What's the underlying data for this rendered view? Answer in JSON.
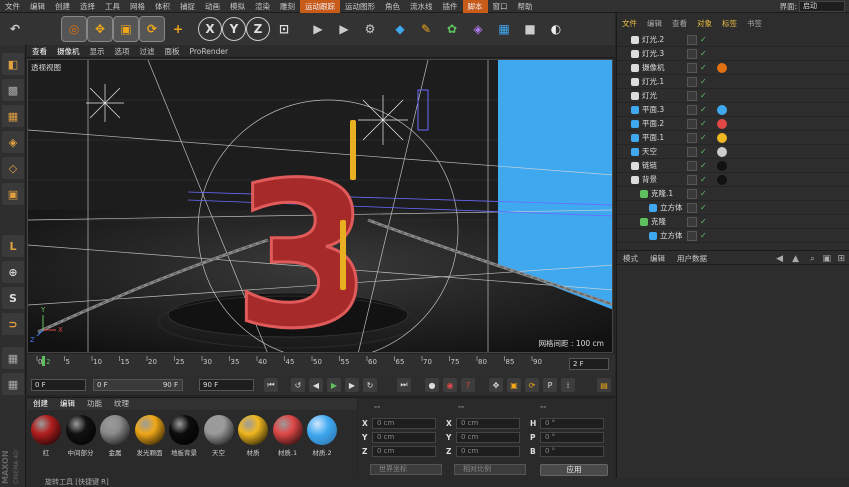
{
  "menubar": {
    "items": [
      "文件",
      "编辑",
      "创建",
      "选择",
      "工具",
      "网格",
      "体积",
      "捕捉",
      "动画",
      "模拟",
      "渲染",
      "雕刻",
      "运动跟踪",
      "运动图形",
      "角色",
      "流水线",
      "插件",
      "脚本",
      "窗口",
      "帮助"
    ],
    "highlighted": [
      "运动跟踪",
      "脚本"
    ],
    "layout_label": "界面:",
    "layout_value": "启动"
  },
  "toolbar": {
    "icons": [
      "undo-icon",
      "live-select-icon",
      "move-icon",
      "scale-icon",
      "rotate-icon",
      "add-icon",
      "x-axis-icon",
      "y-axis-icon",
      "z-axis-icon",
      "coordinate-system-icon",
      "render-region-icon",
      "render-to-viewer-icon",
      "render-settings-icon",
      "cube-icon",
      "pen-icon",
      "subdivision-icon",
      "deformer-icon",
      "scene-icon",
      "camera-icon",
      "light-icon"
    ],
    "axis_labels": [
      "X",
      "Y",
      "Z"
    ]
  },
  "viewport": {
    "menu": [
      "查看",
      "摄像机",
      "显示",
      "选项",
      "过滤",
      "面板",
      "ProRender"
    ],
    "highlighted": [
      "查看",
      "摄像机"
    ],
    "label": "透视视图",
    "grid_spacing": "网格间距 : 100 cm",
    "scene_number": "3",
    "accent_red": "#c83a3a",
    "accent_yellow": "#e8b020",
    "accent_blue": "#3fa8ef"
  },
  "timeline": {
    "ticks": [
      "0",
      "5",
      "10",
      "15",
      "20",
      "25",
      "30",
      "35",
      "40",
      "45",
      "50",
      "55",
      "60",
      "65",
      "70",
      "75",
      "80",
      "85",
      "90"
    ],
    "current_frame": "2 F",
    "playhead_marker": "2"
  },
  "transport": {
    "start": "0 F",
    "range_start": "0 F",
    "range_end": "90 F",
    "end": "90 F"
  },
  "materials": {
    "tabs": [
      "创建",
      "编辑",
      "功能",
      "纹理"
    ],
    "items": [
      {
        "label": "红",
        "color": "#b01e1e"
      },
      {
        "label": "中间部分",
        "color": "#111111"
      },
      {
        "label": "金属",
        "color": "#8a8a8a"
      },
      {
        "label": "发光颗面",
        "color": "#f0a818"
      },
      {
        "label": "地板背景",
        "color": "#0c0c0c"
      },
      {
        "label": "天空",
        "color": "#9a9a9a"
      },
      {
        "label": "材质",
        "color": "#f0b820"
      },
      {
        "label": "材质.1",
        "color": "#e04848"
      },
      {
        "label": "材质.2",
        "color": "#3fa8ef"
      }
    ]
  },
  "coordinates": {
    "header_left": "--",
    "header_mid": "--",
    "header_right": "--",
    "rows": [
      {
        "a": "X",
        "av": "0 cm",
        "b": "X",
        "bv": "0 cm",
        "c": "H",
        "cv": "0 °"
      },
      {
        "a": "Y",
        "av": "0 cm",
        "b": "Y",
        "bv": "0 cm",
        "c": "P",
        "cv": "0 °"
      },
      {
        "a": "Z",
        "av": "0 cm",
        "b": "Z",
        "bv": "0 cm",
        "c": "B",
        "cv": "0 °"
      }
    ],
    "mode_select": "世界坐标",
    "scale_select": "相对比例",
    "apply_label": "应用"
  },
  "object_manager": {
    "tabs": [
      "文件",
      "编辑",
      "查看",
      "对象",
      "标签",
      "书签"
    ],
    "highlighted": [
      "文件",
      "对象",
      "标签"
    ],
    "objects": [
      {
        "name": "灯光.2",
        "indent": 0,
        "type": "light",
        "tag": ""
      },
      {
        "name": "灯光.3",
        "indent": 0,
        "type": "light",
        "tag": ""
      },
      {
        "name": "摄像机",
        "indent": 0,
        "type": "camera",
        "tag": "#e07010"
      },
      {
        "name": "灯光.1",
        "indent": 0,
        "type": "light",
        "tag": ""
      },
      {
        "name": "灯光",
        "indent": 0,
        "type": "light",
        "tag": ""
      },
      {
        "name": "平面.3",
        "indent": 0,
        "type": "plane",
        "tag": "#3fa8ef"
      },
      {
        "name": "平面.2",
        "indent": 0,
        "type": "plane",
        "tag": "#e04848"
      },
      {
        "name": "平面.1",
        "indent": 0,
        "type": "plane",
        "tag": "#f0b820"
      },
      {
        "name": "天空",
        "indent": 0,
        "type": "sky",
        "tag": "#cccccc"
      },
      {
        "name": "链链",
        "indent": 0,
        "type": "null",
        "tag": "#111111"
      },
      {
        "name": "背景",
        "indent": 0,
        "type": "null",
        "tag": "#111111"
      },
      {
        "name": "克隆.1",
        "indent": 1,
        "type": "cloner",
        "tag": ""
      },
      {
        "name": "立方体",
        "indent": 2,
        "type": "cube",
        "tag": ""
      },
      {
        "name": "克隆",
        "indent": 1,
        "type": "cloner",
        "tag": ""
      },
      {
        "name": "立方体",
        "indent": 2,
        "type": "cube",
        "tag": ""
      }
    ]
  },
  "attribute_manager": {
    "tabs": [
      "模式",
      "编辑",
      "用户数据"
    ]
  },
  "statusbar": {
    "text": "旋转工具 [快捷键 R]"
  },
  "brand": {
    "line1": "MAXON",
    "line2": "CINEMA 4D"
  }
}
